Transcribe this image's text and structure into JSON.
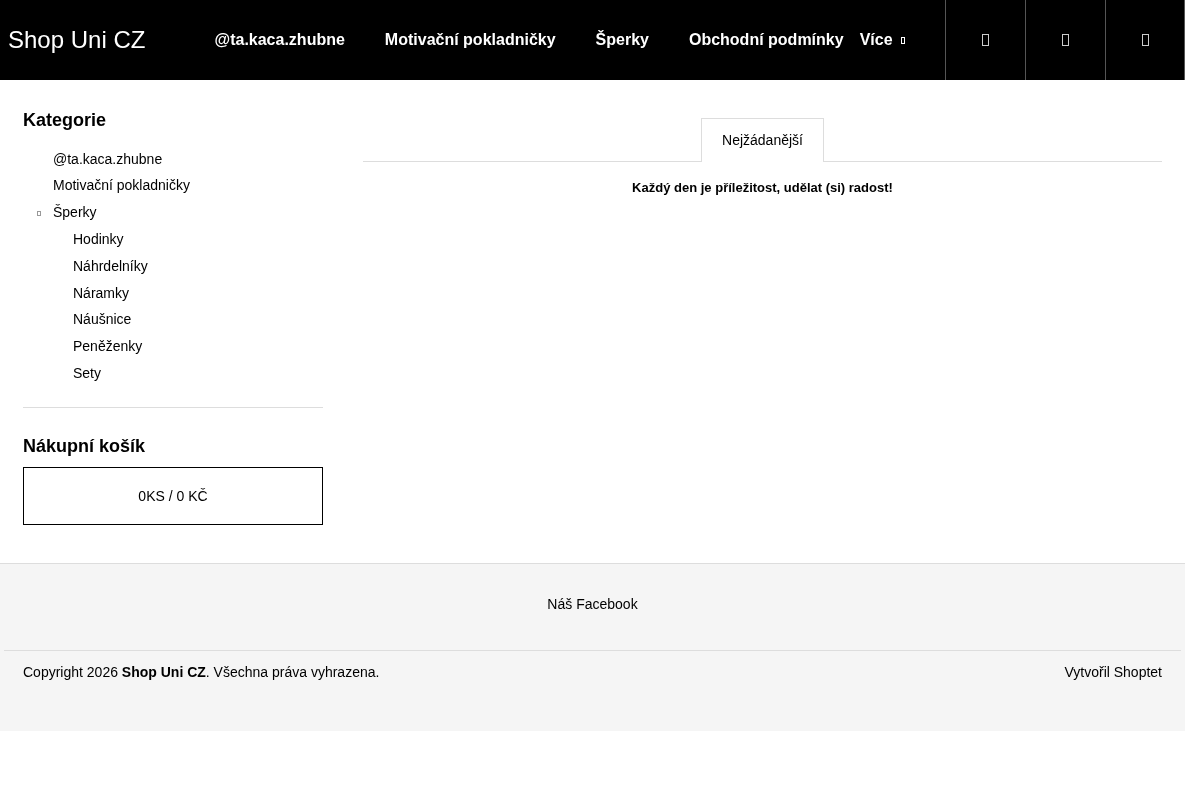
{
  "header": {
    "logo": "Shop Uni CZ",
    "nav": [
      {
        "label": "@ta.kaca.zhubne"
      },
      {
        "label": "Motivační pokladničky"
      },
      {
        "label": "Šperky"
      },
      {
        "label": "Obchodní podmínky"
      },
      {
        "label": "Více",
        "kind": "dropdown"
      }
    ],
    "icon_buttons": [
      {
        "kind": "glyph"
      },
      {
        "kind": "glyph"
      },
      {
        "kind": "glyph"
      }
    ]
  },
  "sidebar": {
    "categories_title": "Kategorie",
    "categories": [
      {
        "label": "@ta.kaca.zhubne"
      },
      {
        "label": "Motivační pokladničky"
      },
      {
        "label": "Šperky",
        "expanded": true,
        "children": [
          {
            "label": "Hodinky"
          },
          {
            "label": "Náhrdelníky"
          },
          {
            "label": "Náramky"
          },
          {
            "label": "Náušnice"
          },
          {
            "label": "Peněženky"
          },
          {
            "label": "Sety"
          }
        ]
      }
    ],
    "cart_title": "Nákupní košík",
    "cart_summary": "0KS / 0 KČ"
  },
  "content": {
    "tabs": [
      {
        "label": "Nejžádanější",
        "selected": true
      }
    ],
    "message": "Každý den je příležitost, udělat (si) radost!"
  },
  "footer": {
    "links": [
      "Náš Facebook"
    ],
    "copyright": "Copyright 2026 **Shop Uni CZ**. Všechna práva vyhrazena.",
    "credit": "Vytvořil Shoptet"
  }
}
